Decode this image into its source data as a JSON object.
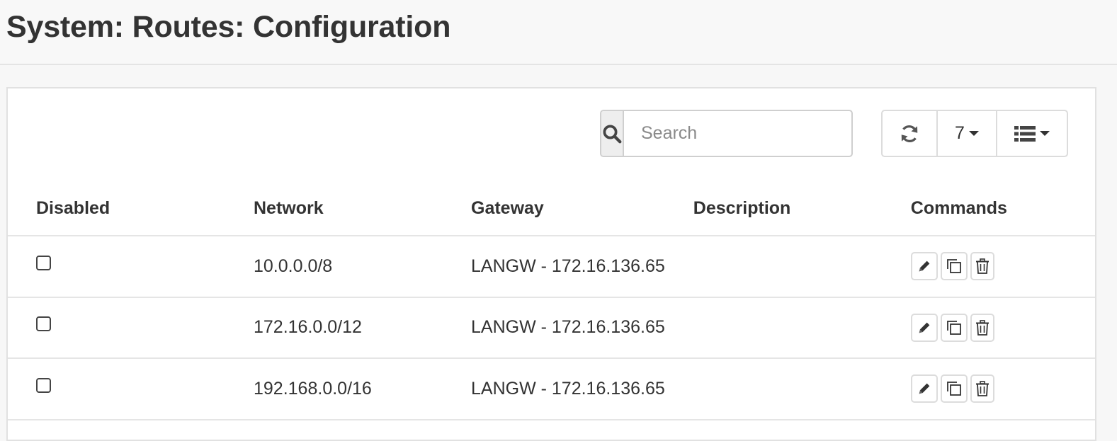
{
  "page": {
    "title": "System: Routes: Configuration"
  },
  "toolbar": {
    "search_placeholder": "Search",
    "search_icon": "search-icon",
    "refresh_icon": "refresh-icon",
    "page_size": "7",
    "columns_icon": "list-icon"
  },
  "table": {
    "headers": {
      "disabled": "Disabled",
      "network": "Network",
      "gateway": "Gateway",
      "description": "Description",
      "commands": "Commands"
    },
    "rows": [
      {
        "disabled": false,
        "network": "10.0.0.0/8",
        "gateway": "LANGW - 172.16.136.65",
        "description": ""
      },
      {
        "disabled": false,
        "network": "172.16.0.0/12",
        "gateway": "LANGW - 172.16.136.65",
        "description": ""
      },
      {
        "disabled": false,
        "network": "192.168.0.0/16",
        "gateway": "LANGW - 172.16.136.65",
        "description": ""
      }
    ],
    "row_commands": [
      "edit-icon",
      "copy-icon",
      "trash-icon"
    ]
  },
  "colors": {
    "header_bg": "#f8f8f8",
    "panel_bg": "#ffffff",
    "text": "#333333",
    "border": "#dcdcdc"
  }
}
